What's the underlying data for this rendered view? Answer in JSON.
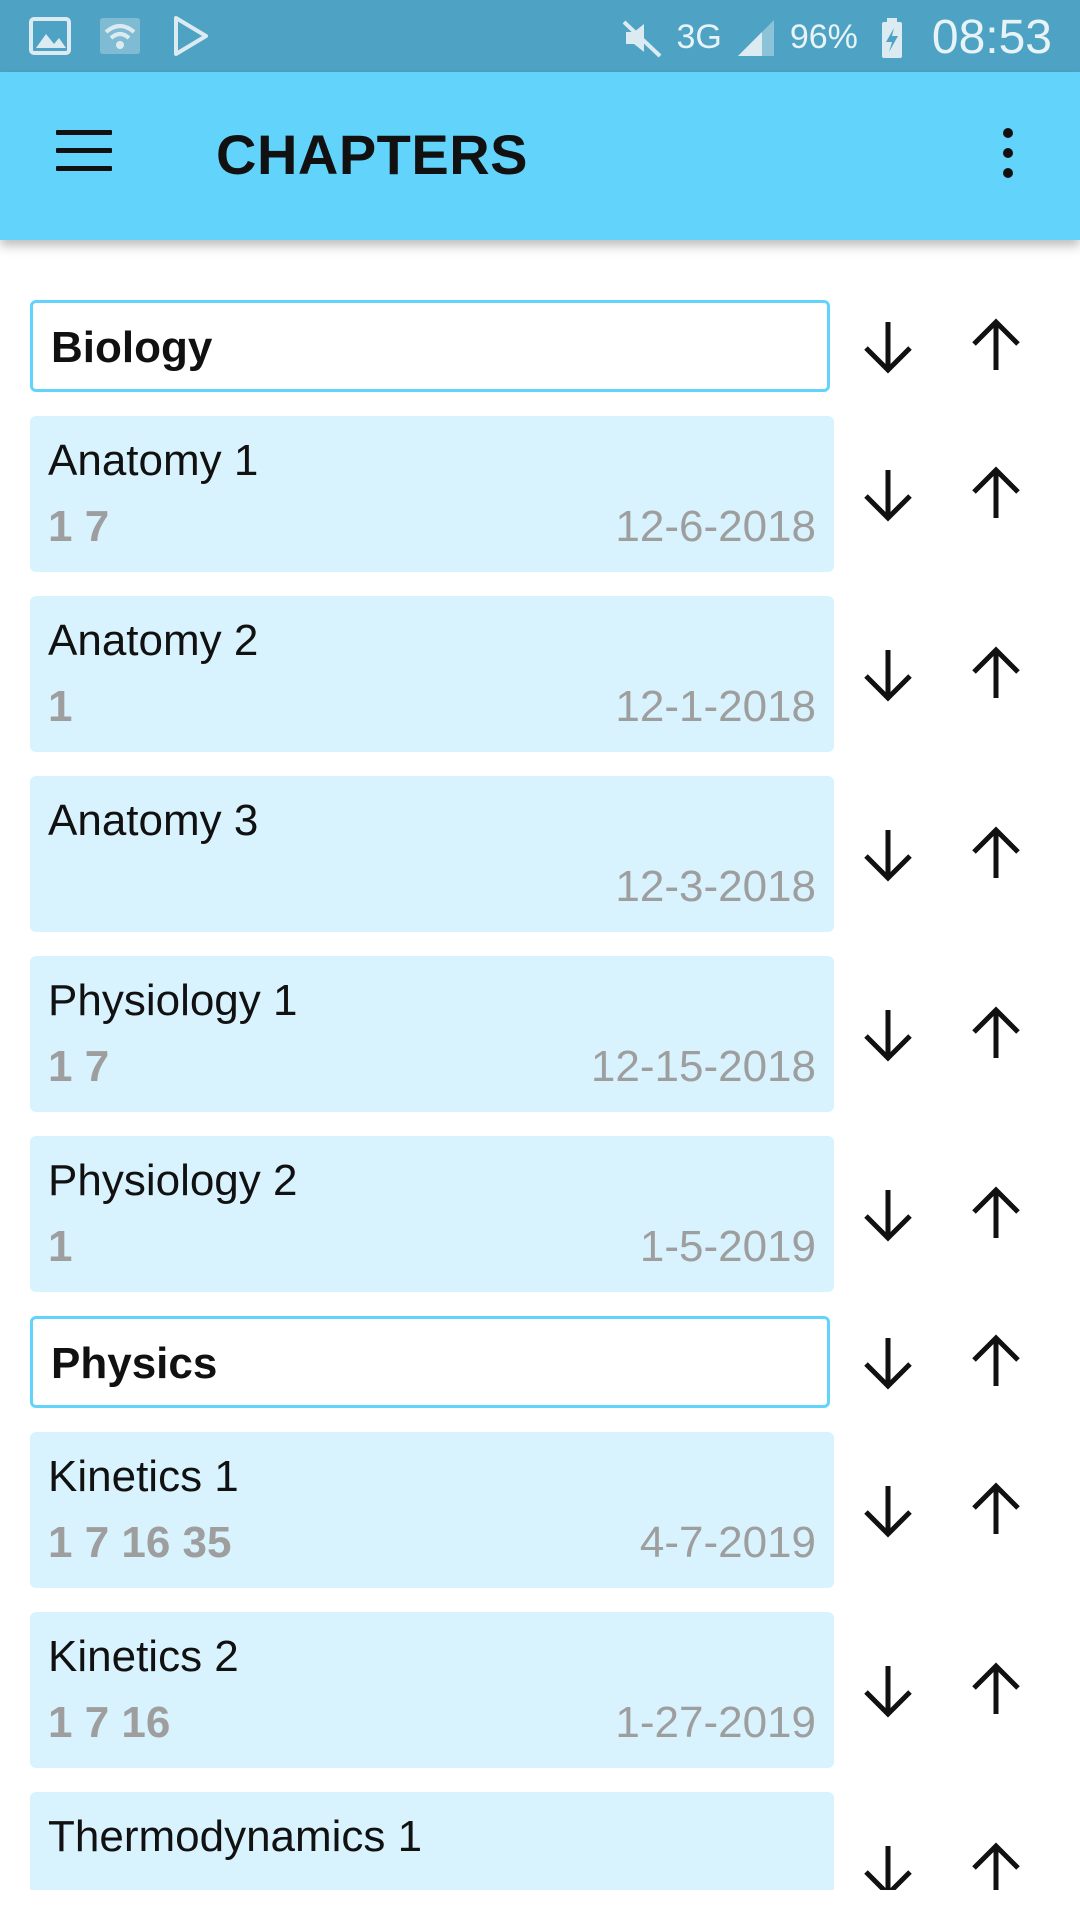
{
  "status_bar": {
    "battery": "96%",
    "network": "3G",
    "time": "08:53"
  },
  "app_bar": {
    "title": "CHAPTERS"
  },
  "list": [
    {
      "type": "header",
      "label": "Biology"
    },
    {
      "type": "item",
      "name": "Anatomy 1",
      "nums": "1 7",
      "date": "12-6-2018"
    },
    {
      "type": "item",
      "name": "Anatomy 2",
      "nums": "1",
      "date": "12-1-2018"
    },
    {
      "type": "item",
      "name": "Anatomy 3",
      "nums": "",
      "date": "12-3-2018"
    },
    {
      "type": "item",
      "name": "Physiology 1",
      "nums": "1 7",
      "date": "12-15-2018"
    },
    {
      "type": "item",
      "name": "Physiology 2",
      "nums": "1",
      "date": "1-5-2019"
    },
    {
      "type": "header",
      "label": "Physics"
    },
    {
      "type": "item",
      "name": "Kinetics 1",
      "nums": "1 7 16 35",
      "date": "4-7-2019"
    },
    {
      "type": "item",
      "name": "Kinetics 2",
      "nums": "1 7 16",
      "date": "1-27-2019"
    },
    {
      "type": "item",
      "name": "Thermodynamics 1",
      "nums": "",
      "date": ""
    }
  ],
  "icons": {
    "status_left": [
      "gallery-icon",
      "wifi-icon",
      "play-store-icon"
    ],
    "status_right": [
      "mute-icon",
      "signal-icon",
      "battery-charging-icon"
    ],
    "row_actions": [
      "arrow-down-icon",
      "arrow-up-icon"
    ]
  },
  "colors": {
    "status_bar": "#4ea3c4",
    "app_bar": "#62d4fc",
    "item_background": "#d8f3fd",
    "header_border": "#62d4fc",
    "secondary_text": "#9e9e9e"
  }
}
